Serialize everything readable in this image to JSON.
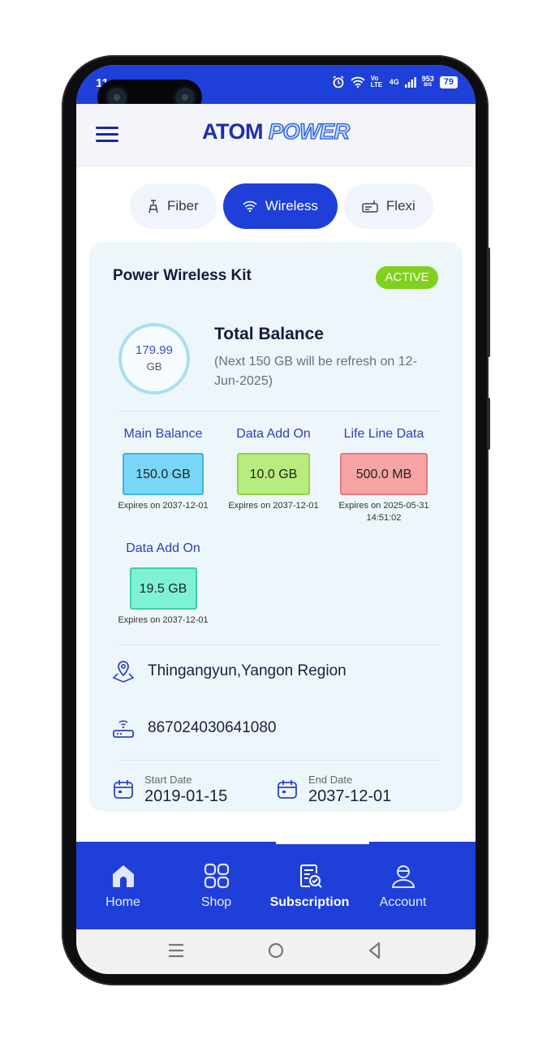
{
  "status_bar": {
    "time": "11",
    "network": "4G",
    "speed": "953",
    "speed_unit": "B/S",
    "battery": "79",
    "volte": "Vo LTE"
  },
  "header": {
    "logo_part1": "ATOM",
    "logo_part2": "POWER"
  },
  "tabs": [
    {
      "label": "Fiber",
      "icon": "antenna-icon"
    },
    {
      "label": "Wireless",
      "icon": "wifi-icon",
      "active": true
    },
    {
      "label": "Flexi",
      "icon": "router-box-icon"
    }
  ],
  "plan": {
    "name": "Power Wireless Kit",
    "status": "ACTIVE",
    "total_value": "179.99",
    "total_unit": "GB",
    "total_title": "Total Balance",
    "total_note": "(Next 150 GB will be refresh on 12-Jun-2025)"
  },
  "balances": [
    {
      "label": "Main Balance",
      "value": "150.0 GB",
      "expires": "Expires on 2037-12-01",
      "color": "#79d6f6"
    },
    {
      "label": "Data Add On",
      "value": "10.0 GB",
      "expires": "Expires on 2037-12-01",
      "color": "#b8ec7c"
    },
    {
      "label": "Life Line Data",
      "value": "500.0 MB",
      "expires": "Expires on 2025-05-31 14:51:02",
      "color": "#f6a3a3"
    },
    {
      "label": "Data Add On",
      "value": "19.5 GB",
      "expires": "Expires on 2037-12-01",
      "color": "#7ff1d6"
    }
  ],
  "details": {
    "location": "Thingangyun,Yangon Region",
    "device_id": "867024030641080",
    "start_label": "Start Date",
    "start_value": "2019-01-15",
    "end_label": "End Date",
    "end_value": "2037-12-01"
  },
  "bottom_nav": [
    {
      "label": "Home",
      "icon": "home-icon"
    },
    {
      "label": "Shop",
      "icon": "grid-icon"
    },
    {
      "label": "Subscription",
      "icon": "subscription-icon",
      "active": true
    },
    {
      "label": "Account",
      "icon": "account-icon"
    }
  ],
  "colors": {
    "primary": "#1f3fd9",
    "active_badge": "#7fd11e",
    "card_bg": "#edf6fa"
  }
}
